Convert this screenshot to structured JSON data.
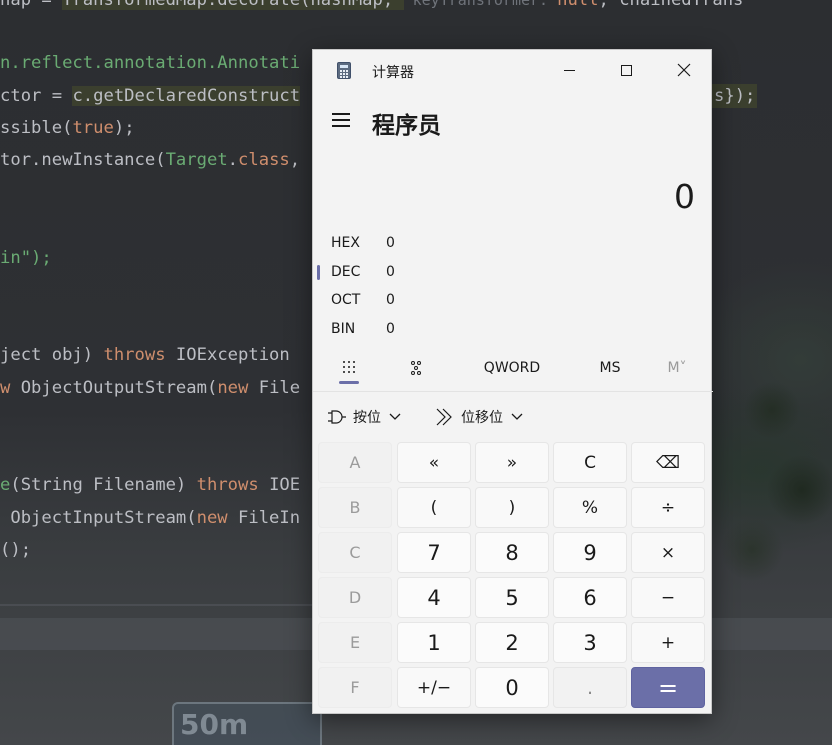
{
  "ide": {
    "lines": [
      {
        "segments": [
          {
            "t": "nap = ",
            "c": ""
          },
          {
            "t": "TransformedMap.decorate(hashMap, ",
            "c": "hl"
          },
          {
            "t": " keyTransformer: ",
            "c": "hint"
          },
          {
            "t": "null",
            "c": "kw"
          },
          {
            "t": ", chainedTrans",
            "c": ""
          }
        ]
      },
      {
        "segments": [
          {
            "t": "n.reflect.annotation.Annotati",
            "c": "str"
          }
        ]
      },
      {
        "segments": [
          {
            "t": "ctor = ",
            "c": ""
          },
          {
            "t": "c.getDeclaredConstruct",
            "c": "hl"
          }
        ]
      },
      {
        "segments": [
          {
            "t": "ssible(",
            "c": ""
          },
          {
            "t": "true",
            "c": "kw"
          },
          {
            "t": ");",
            "c": ""
          }
        ]
      },
      {
        "segments": [
          {
            "t": "tor.newInstance(",
            "c": ""
          },
          {
            "t": "Target",
            "c": "str"
          },
          {
            "t": ".",
            "c": ""
          },
          {
            "t": "class",
            "c": "kw"
          },
          {
            "t": ",",
            "c": ""
          }
        ]
      },
      {
        "segments": [
          {
            "t": "in\");",
            "c": "str"
          }
        ]
      },
      {
        "segments": [
          {
            "t": "ject obj) ",
            "c": ""
          },
          {
            "t": "throws",
            "c": "kw"
          },
          {
            "t": " IOException",
            "c": ""
          }
        ]
      },
      {
        "segments": [
          {
            "t": "w",
            "c": "kw"
          },
          {
            "t": " ObjectOutputStream(",
            "c": ""
          },
          {
            "t": "new",
            "c": "kw"
          },
          {
            "t": " File",
            "c": ""
          }
        ]
      },
      {
        "segments": [
          {
            "t": "e",
            "c": "str"
          },
          {
            "t": "(String Filename) ",
            "c": ""
          },
          {
            "t": "throws",
            "c": "kw"
          },
          {
            "t": " IOE",
            "c": ""
          }
        ]
      },
      {
        "segments": [
          {
            "t": " ObjectInputStream(",
            "c": ""
          },
          {
            "t": "new",
            "c": "kw"
          },
          {
            "t": " FileIn",
            "c": ""
          }
        ]
      },
      {
        "segments": [
          {
            "t": "();",
            "c": ""
          }
        ]
      }
    ],
    "right_fragment": "s});",
    "sign_text": "50m"
  },
  "calculator": {
    "window_title": "计算器",
    "icons": {
      "app": "calculator-app-icon",
      "menu": "hamburger-menu-icon",
      "minimize": "minimize-icon",
      "maximize": "maximize-icon",
      "close": "close-icon"
    },
    "mode_title": "程序员",
    "display_value": "0",
    "radix": [
      {
        "label": "HEX",
        "value": "0",
        "active": false
      },
      {
        "label": "DEC",
        "value": "0",
        "active": true
      },
      {
        "label": "OCT",
        "value": "0",
        "active": false
      },
      {
        "label": "BIN",
        "value": "0",
        "active": false
      }
    ],
    "tabs": {
      "keypad_icon": "full-keypad-icon",
      "bits_icon": "bit-toggling-keypad-icon",
      "word_size": "QWORD",
      "memory_store": "MS",
      "memory_list": "M˅"
    },
    "operators": {
      "bitwise": "按位",
      "bitshift": "位移位"
    },
    "keys": [
      [
        "A",
        "«",
        "»",
        "C",
        "⌫"
      ],
      [
        "B",
        "(",
        ")",
        "%",
        "÷"
      ],
      [
        "C",
        "7",
        "8",
        "9",
        "×"
      ],
      [
        "D",
        "4",
        "5",
        "6",
        "−"
      ],
      [
        "E",
        "1",
        "2",
        "3",
        "+"
      ],
      [
        "F",
        "+/−",
        "0",
        ".",
        "="
      ]
    ],
    "accent_color": "#6b6fa8"
  }
}
